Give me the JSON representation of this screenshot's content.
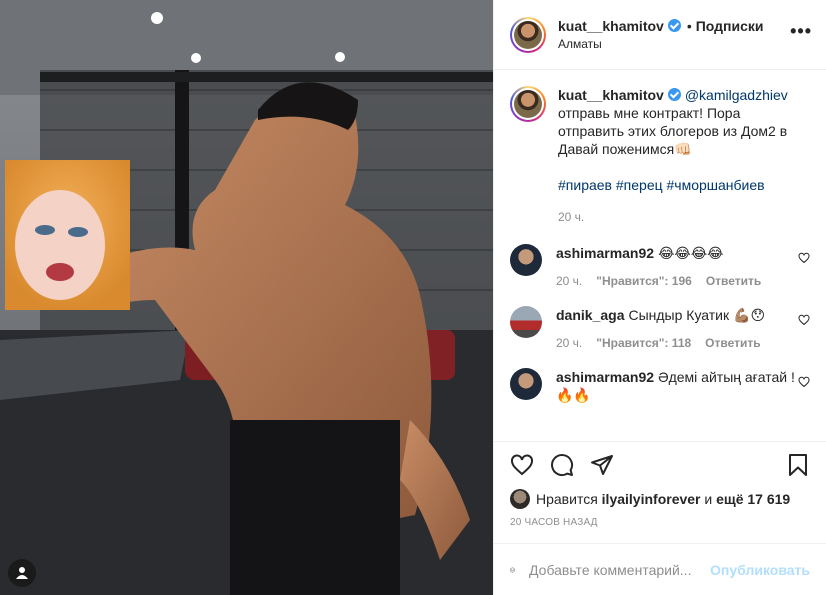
{
  "post": {
    "author": "kuat__khamitov",
    "follow_label": "Подписки",
    "location": "Алматы",
    "more_label": "•••"
  },
  "caption": {
    "author": "kuat__khamitov",
    "mention": "@kamilgadzhiev",
    "text": "отправь мне контракт! Пора отправить этих блогеров из Дом2 в Давай поженимся👊🏻",
    "hashtags": "#пираев #перец #чморшанбиев",
    "time": "20 ч."
  },
  "comments": [
    {
      "user": "ashimarman92",
      "text": "😂😂😂😂",
      "time": "20 ч.",
      "likes": "\"Нравится\": 196",
      "reply": "Ответить"
    },
    {
      "user": "danik_aga",
      "text": "Сындыр Куатик 💪🏽😯",
      "time": "20 ч.",
      "likes": "\"Нравится\": 118",
      "reply": "Ответить"
    },
    {
      "user": "ashimarman92",
      "text": "Әдемі айтың ағатай ! 🔥🔥",
      "time": "",
      "likes": "",
      "reply": ""
    }
  ],
  "likes": {
    "prefix": "Нравится",
    "user": "ilyailyinforever",
    "and": "и",
    "count": "ещё 17 619"
  },
  "time_ago": "20 ЧАСОВ НАЗАД",
  "add_comment": {
    "placeholder": "Добавьте комментарий...",
    "publish": "Опубликовать"
  },
  "icons": {
    "like": "heart-icon",
    "comment": "comment-icon",
    "share": "paper-plane-icon",
    "save": "bookmark-icon",
    "emoji": "smiley-icon",
    "user_tags": "user-icon"
  }
}
